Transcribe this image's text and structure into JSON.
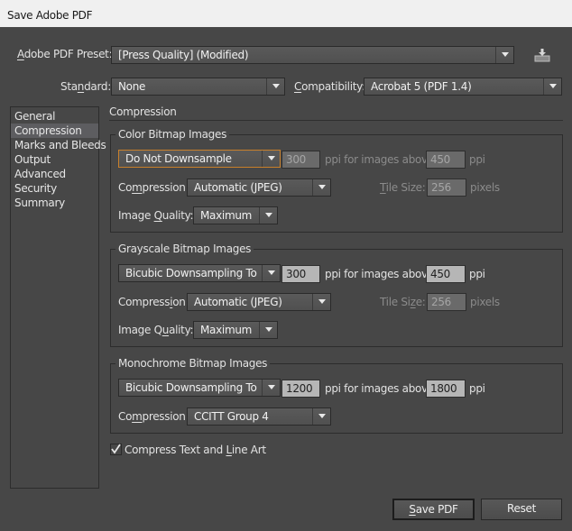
{
  "window": {
    "title": "Save Adobe PDF"
  },
  "header": {
    "preset_label": "Adobe PDF Preset:",
    "preset_value": "[Press Quality] (Modified)",
    "save_preset_icon": "save-preset-icon",
    "standard_label": "Standard:",
    "standard_value": "None",
    "compatibility_label": "Compatibility:",
    "compatibility_value": "Acrobat 5 (PDF 1.4)"
  },
  "sidebar": {
    "items": [
      {
        "label": "General",
        "active": false
      },
      {
        "label": "Compression",
        "active": true
      },
      {
        "label": "Marks and Bleeds",
        "active": false
      },
      {
        "label": "Output",
        "active": false
      },
      {
        "label": "Advanced",
        "active": false
      },
      {
        "label": "Security",
        "active": false
      },
      {
        "label": "Summary",
        "active": false
      }
    ]
  },
  "main": {
    "section_title": "Compression",
    "color": {
      "title": "Color Bitmap Images",
      "downsample_value": "Do Not Downsample",
      "ppi_value": "300",
      "ppi_text": "ppi for images above",
      "above_value": "450",
      "ppi_unit": "ppi",
      "compression_label": "Compression:",
      "compression_value": "Automatic (JPEG)",
      "tile_label": "Tile Size:",
      "tile_value": "256",
      "tile_unit": "pixels",
      "quality_label": "Image Quality:",
      "quality_value": "Maximum"
    },
    "grayscale": {
      "title": "Grayscale Bitmap Images",
      "downsample_value": "Bicubic Downsampling To",
      "ppi_value": "300",
      "ppi_text": "ppi for images above",
      "above_value": "450",
      "ppi_unit": "ppi",
      "compression_label": "Compression:",
      "compression_value": "Automatic (JPEG)",
      "tile_label": "Tile Size:",
      "tile_value": "256",
      "tile_unit": "pixels",
      "quality_label": "Image Quality:",
      "quality_value": "Maximum"
    },
    "monochrome": {
      "title": "Monochrome Bitmap Images",
      "downsample_value": "Bicubic Downsampling To",
      "ppi_value": "1200",
      "ppi_text": "ppi for images above",
      "above_value": "1800",
      "ppi_unit": "ppi",
      "compression_label": "Compression:",
      "compression_value": "CCITT Group 4"
    },
    "compress_text": {
      "label": "Compress Text and Line Art",
      "checked": true
    }
  },
  "footer": {
    "save_label": "Save PDF",
    "reset_label": "Reset"
  }
}
